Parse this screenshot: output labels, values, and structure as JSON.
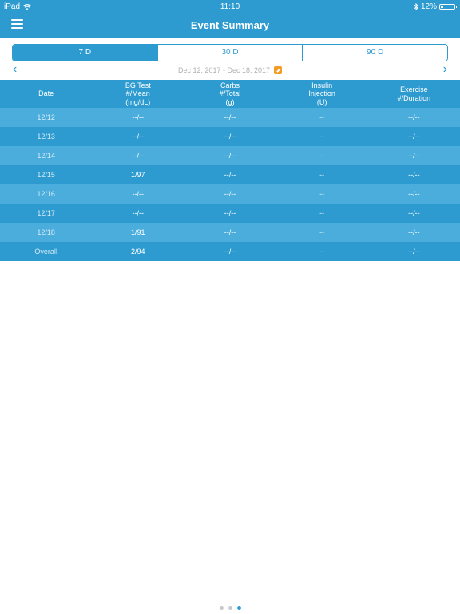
{
  "status_bar": {
    "device": "iPad",
    "time": "11:10",
    "battery": "12%"
  },
  "header": {
    "title": "Event Summary"
  },
  "segments": [
    "7 D",
    "30 D",
    "90 D"
  ],
  "selected_segment": "7 D",
  "date_range": "Dec 12, 2017 - Dec 18, 2017",
  "table": {
    "columns": [
      {
        "lines": [
          "Date"
        ]
      },
      {
        "lines": [
          "BG Test",
          "#/Mean",
          "(mg/dL)"
        ]
      },
      {
        "lines": [
          "Carbs",
          "#/Total",
          "(g)"
        ]
      },
      {
        "lines": [
          "Insulin",
          "Injection",
          "(U)"
        ]
      },
      {
        "lines": [
          "Exercise",
          "#/Duration"
        ]
      }
    ],
    "rows": [
      [
        "12/12",
        "--/--",
        "--/--",
        "--",
        "--/--"
      ],
      [
        "12/13",
        "--/--",
        "--/--",
        "--",
        "--/--"
      ],
      [
        "12/14",
        "--/--",
        "--/--",
        "--",
        "--/--"
      ],
      [
        "12/15",
        "1/97",
        "--/--",
        "--",
        "--/--"
      ],
      [
        "12/16",
        "--/--",
        "--/--",
        "--",
        "--/--"
      ],
      [
        "12/17",
        "--/--",
        "--/--",
        "--",
        "--/--"
      ],
      [
        "12/18",
        "1/91",
        "--/--",
        "--",
        "--/--"
      ],
      [
        "Overall",
        "2/94",
        "--/--",
        "--",
        "--/--"
      ]
    ]
  },
  "pager": {
    "count": 3,
    "active_index": 2
  },
  "colors": {
    "accent": "#2e9bd0",
    "row_alt": "#4aaddb",
    "edit_icon": "#f59a23"
  }
}
